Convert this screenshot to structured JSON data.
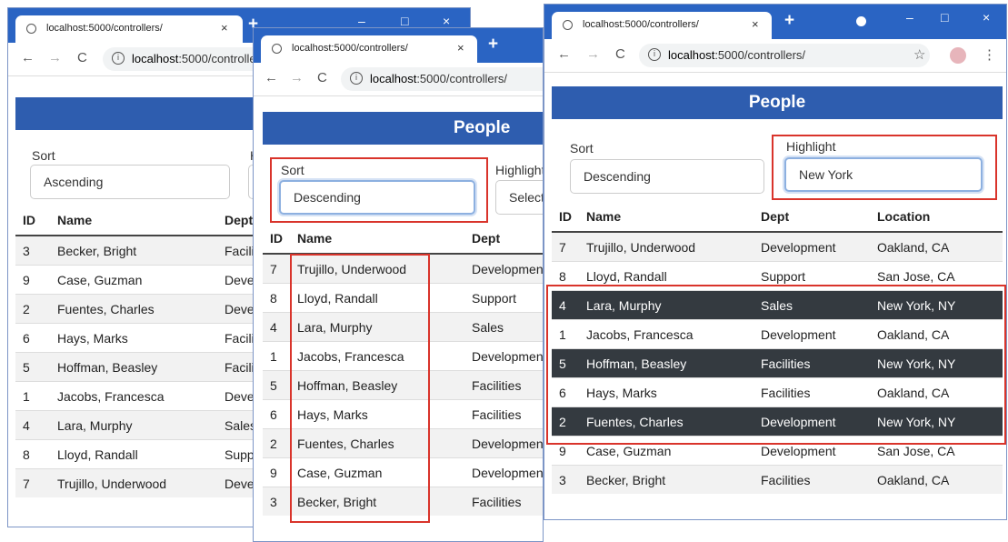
{
  "browser": {
    "tab_title": "localhost:5000/controllers/",
    "tab_close": "×",
    "new_tab": "+",
    "minimize": "–",
    "maximize": "□",
    "close": "×",
    "back": "←",
    "forward": "→",
    "reload": "C",
    "url_host": "localhost",
    "url_rest": ":5000/controllers/",
    "star": "☆",
    "menu": "⋮"
  },
  "page": {
    "title": "People",
    "sort_label": "Sort",
    "highlight_label": "Highlight",
    "columns": [
      "ID",
      "Name",
      "Dept",
      "Location"
    ]
  },
  "window1": {
    "sort_value": "Ascending",
    "rows": [
      {
        "id": "3",
        "name": "Becker, Bright",
        "dept": "Facilities"
      },
      {
        "id": "9",
        "name": "Case, Guzman",
        "dept": "Development"
      },
      {
        "id": "2",
        "name": "Fuentes, Charles",
        "dept": "Development"
      },
      {
        "id": "6",
        "name": "Hays, Marks",
        "dept": "Facilities"
      },
      {
        "id": "5",
        "name": "Hoffman, Beasley",
        "dept": "Facilities"
      },
      {
        "id": "1",
        "name": "Jacobs, Francesca",
        "dept": "Development"
      },
      {
        "id": "4",
        "name": "Lara, Murphy",
        "dept": "Sales"
      },
      {
        "id": "8",
        "name": "Lloyd, Randall",
        "dept": "Support"
      },
      {
        "id": "7",
        "name": "Trujillo, Underwood",
        "dept": "Development"
      }
    ]
  },
  "window2": {
    "sort_value": "Descending",
    "highlight_value": "Select",
    "rows": [
      {
        "id": "7",
        "name": "Trujillo, Underwood",
        "dept": "Development"
      },
      {
        "id": "8",
        "name": "Lloyd, Randall",
        "dept": "Support"
      },
      {
        "id": "4",
        "name": "Lara, Murphy",
        "dept": "Sales"
      },
      {
        "id": "1",
        "name": "Jacobs, Francesca",
        "dept": "Development"
      },
      {
        "id": "5",
        "name": "Hoffman, Beasley",
        "dept": "Facilities"
      },
      {
        "id": "6",
        "name": "Hays, Marks",
        "dept": "Facilities"
      },
      {
        "id": "2",
        "name": "Fuentes, Charles",
        "dept": "Development"
      },
      {
        "id": "9",
        "name": "Case, Guzman",
        "dept": "Development"
      },
      {
        "id": "3",
        "name": "Becker, Bright",
        "dept": "Facilities"
      }
    ]
  },
  "window3": {
    "sort_value": "Descending",
    "highlight_value": "New York",
    "rows": [
      {
        "id": "7",
        "name": "Trujillo, Underwood",
        "dept": "Development",
        "location": "Oakland, CA",
        "highlighted": false
      },
      {
        "id": "8",
        "name": "Lloyd, Randall",
        "dept": "Support",
        "location": "San Jose, CA",
        "highlighted": false
      },
      {
        "id": "4",
        "name": "Lara, Murphy",
        "dept": "Sales",
        "location": "New York, NY",
        "highlighted": true
      },
      {
        "id": "1",
        "name": "Jacobs, Francesca",
        "dept": "Development",
        "location": "Oakland, CA",
        "highlighted": false
      },
      {
        "id": "5",
        "name": "Hoffman, Beasley",
        "dept": "Facilities",
        "location": "New York, NY",
        "highlighted": true
      },
      {
        "id": "6",
        "name": "Hays, Marks",
        "dept": "Facilities",
        "location": "Oakland, CA",
        "highlighted": false
      },
      {
        "id": "2",
        "name": "Fuentes, Charles",
        "dept": "Development",
        "location": "New York, NY",
        "highlighted": true
      },
      {
        "id": "9",
        "name": "Case, Guzman",
        "dept": "Development",
        "location": "San Jose, CA",
        "highlighted": false
      },
      {
        "id": "3",
        "name": "Becker, Bright",
        "dept": "Facilities",
        "location": "Oakland, CA",
        "highlighted": false
      }
    ]
  }
}
